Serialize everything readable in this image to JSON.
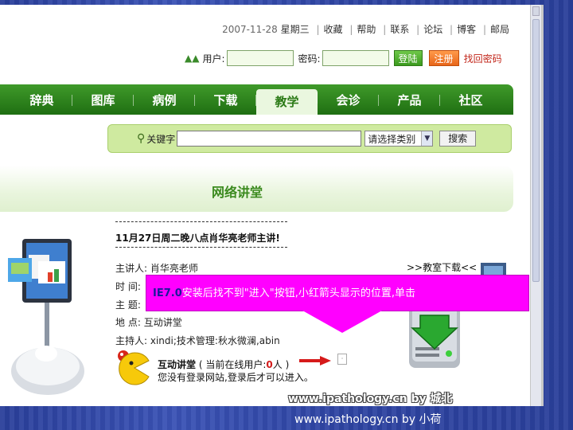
{
  "topbar": {
    "date": "2007-11-28",
    "weekday": "星期三",
    "links": [
      "收藏",
      "帮助",
      "联系",
      "论坛",
      "博客",
      "邮局"
    ]
  },
  "login": {
    "user_label": "用户:",
    "password_label": "密码:",
    "login_button": "登陆",
    "register_button": "注册",
    "forgot_link": "找回密码"
  },
  "nav": {
    "items": [
      "辞典",
      "图库",
      "病例",
      "下载",
      "教学",
      "会诊",
      "产品",
      "社区"
    ],
    "active": "教学"
  },
  "search": {
    "label": "关键字",
    "category_select": "请选择类别",
    "button": "搜索"
  },
  "section": {
    "title": "网络讲堂"
  },
  "lecture": {
    "title": "11月27日周二晚八点肖华亮老师主讲!",
    "speaker_label": "主讲人:",
    "speaker": "肖华亮老师",
    "time_label": "时 间:",
    "topic_label": "主 题:",
    "location_label": "地 点:",
    "location": "互动讲堂",
    "host_label": "主持人:",
    "host": "xindi;技术管理:秋水微澜,abin",
    "download_link": ">>教室下载<<"
  },
  "callout": {
    "browser": "IE7.0",
    "text": "安装后找不到\"进入\"按钮,小红箭头显示的位置,单击"
  },
  "interactive": {
    "title": "互动讲堂",
    "online_prefix": "( 当前在线用户:",
    "online_count": "0",
    "online_suffix": "人 )",
    "notice": "您没有登录网站,登录后才可以进入。"
  },
  "watermarks": {
    "inner": "www.ipathology.cn  by 城北",
    "slide": "www.ipathology.cn  by 小荷"
  },
  "colors": {
    "nav_green": "#2b7a16",
    "callout_magenta": "#ff00ff",
    "slide_blue": "#2e44a2"
  }
}
